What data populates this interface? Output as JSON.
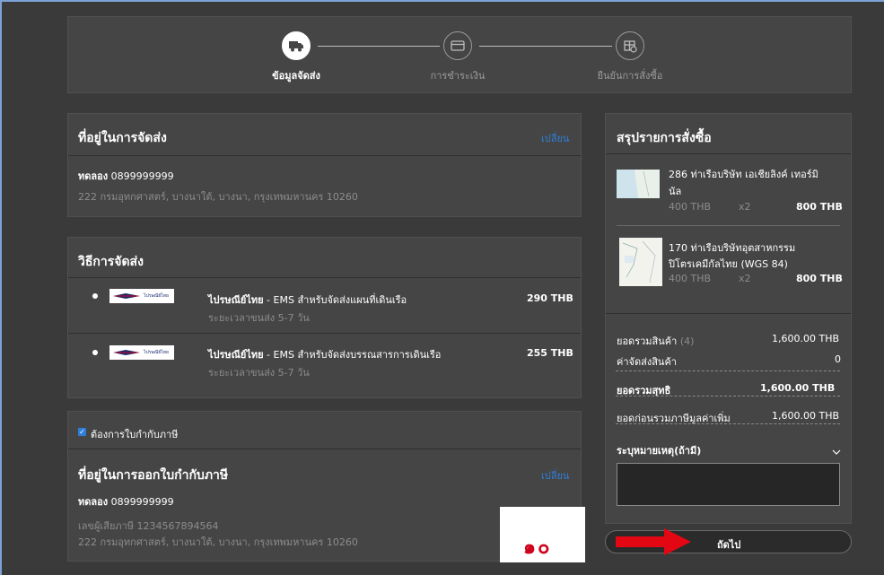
{
  "steps": [
    {
      "label": "ข้อมูลจัดส่ง",
      "icon": "truck-icon",
      "active": true
    },
    {
      "label": "การชำระเงิน",
      "icon": "credit-card-icon",
      "active": false
    },
    {
      "label": "ยืนยันการสั่งซื้อ",
      "icon": "box-check-icon",
      "active": false
    }
  ],
  "shipping_address": {
    "title": "ที่อยู่ในการจัดส่ง",
    "change_label": "เปลี่ยน",
    "name": "ทดลอง",
    "phone": "0899999999",
    "address": "222 กรมอุทกศาสตร์, บางนาใต้, บางนา, กรุงเทพมหานคร 10260"
  },
  "shipping_method": {
    "title": "วิธีการจัดส่ง",
    "options": [
      {
        "carrier": "ไปรษณีย์ไทย",
        "desc": " - EMS สำหรับจัดส่งแผนที่เดินเรือ",
        "duration": "ระยะเวลาขนส่ง 5-7 วัน",
        "price": "290 THB",
        "logo_text": "ไปรษณีย์ไทย"
      },
      {
        "carrier": "ไปรษณีย์ไทย",
        "desc": " - EMS สำหรับจัดส่งบรรณสารการเดินเรือ",
        "duration": "ระยะเวลาขนส่ง 5-7 วัน",
        "price": "255 THB",
        "logo_text": "ไปรษณีย์ไทย"
      }
    ]
  },
  "tax_invoice": {
    "checkbox_label": "ต้องการใบกำกับภาษี",
    "title": "ที่อยู่ในการออกใบกำกับภาษี",
    "change_label": "เปลี่ยน",
    "name": "ทดลอง",
    "phone": "0899999999",
    "tax_id": "เลขผู้เสียภาษี 1234567894564",
    "address": "222 กรมอุทกศาสตร์, บางนาใต้, บางนา, กรุงเทพมหานคร 10260"
  },
  "summary": {
    "title": "สรุปรายการสั่งซื้อ",
    "items": [
      {
        "name_line1": "286 ท่าเรือบริษัท เอเชียลิงค์ เทอร์มิ",
        "name_line2": "นัล",
        "unit_price": "400 THB",
        "qty": "x2",
        "total": "800 THB"
      },
      {
        "name_line1": "170 ท่าเรือบริษัทอุตสาหกรรม",
        "name_line2": "ปิโตรเคมีกัลไทย (WGS 84)",
        "unit_price": "400 THB",
        "qty": "x2",
        "total": "800 THB"
      }
    ],
    "subtotal_label": "ยอดรวมสินค้า",
    "subtotal_count": "(4)",
    "subtotal_value": "1,600.00 THB",
    "shipping_label": "ค่าจัดส่งสินค้า",
    "shipping_value": "0",
    "net_label": "ยอดรวมสุทธิ",
    "net_value": "1,600.00 THB",
    "pre_vat_label": "ยอดก่อนรวมภาษีมูลค่าเพิ่ม",
    "pre_vat_value": "1,600.00 THB",
    "note_label": "ระบุหมายเหตุ(ถ้ามี)"
  },
  "next_button_label": "ถัดไป",
  "annotation_number": "๑๐",
  "colors": {
    "link": "#2f7fd9",
    "arrow": "#e30613",
    "annotation": "#d0021b"
  }
}
